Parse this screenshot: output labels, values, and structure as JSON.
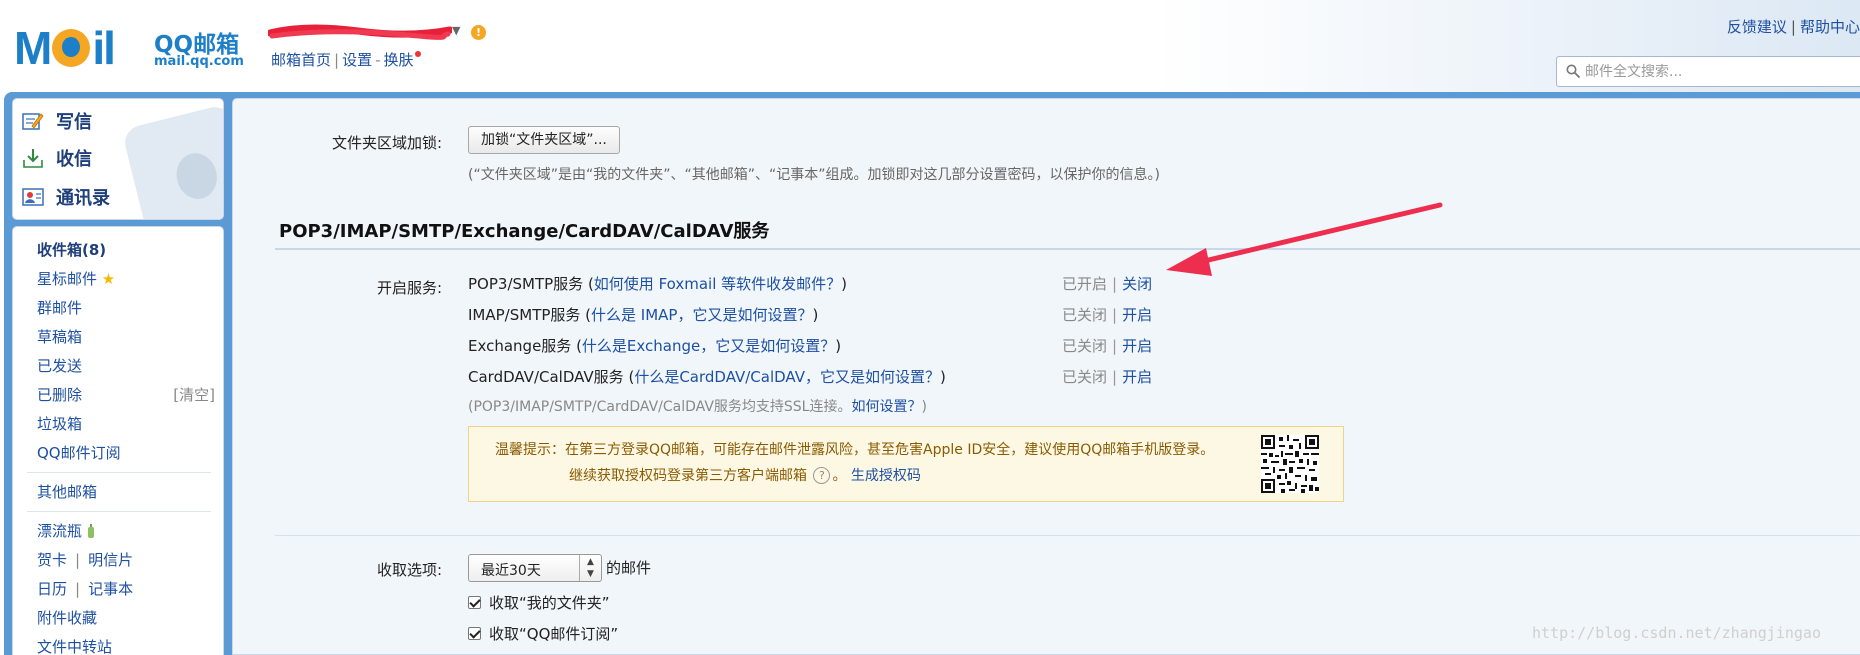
{
  "header": {
    "logo_text": "MOil",
    "logo_name": "QQ邮箱",
    "logo_domain": "mail.qq.com",
    "user_links": [
      "邮箱首页",
      "设置",
      "换肤"
    ],
    "user_links_sep_a": "|",
    "user_links_sep_b": "-",
    "top_right": [
      "反馈建议",
      "帮助中心"
    ],
    "top_right_sep": "|",
    "search_placeholder": "邮件全文搜索..."
  },
  "quick": {
    "write": "写信",
    "receive": "收信",
    "contacts": "通讯录"
  },
  "nav": {
    "inbox": "收件箱(8)",
    "starred": "星标邮件",
    "group": "群邮件",
    "drafts": "草稿箱",
    "sent": "已发送",
    "deleted": "已删除",
    "deleted_aux": "[清空]",
    "spam": "垃圾箱",
    "subscription": "QQ邮件订阅",
    "other": "其他邮箱",
    "bottle": "漂流瓶",
    "card": "贺卡",
    "postcard": "明信片",
    "calendar": "日历",
    "notepad": "记事本",
    "attachments": "附件收藏",
    "transfer": "文件中转站",
    "sep": "|"
  },
  "main": {
    "folder_lock_label": "文件夹区域加锁:",
    "folder_lock_button": "加锁“文件夹区域”...",
    "folder_lock_hint": "(“文件夹区域”是由“我的文件夹”、“其他邮箱”、“记事本”组成。加锁即对这几部分设置密码，以保护你的信息。)",
    "section_title": "POP3/IMAP/SMTP/Exchange/CardDAV/CalDAV服务",
    "services_label": "开启服务:",
    "services": [
      {
        "name": "POP3/SMTP服务",
        "help": "如何使用 Foxmail 等软件收发邮件？",
        "status": "已开启",
        "action": "关闭"
      },
      {
        "name": "IMAP/SMTP服务",
        "help": "什么是 IMAP，它又是如何设置？",
        "status": "已关闭",
        "action": "开启"
      },
      {
        "name": "Exchange服务",
        "help": "什么是Exchange，它又是如何设置？",
        "status": "已关闭",
        "action": "开启"
      },
      {
        "name": "CardDAV/CalDAV服务",
        "help": "什么是CardDAV/CalDAV，它又是如何设置？",
        "status": "已关闭",
        "action": "开启"
      }
    ],
    "status_sep": "|",
    "ssl_note": "(POP3/IMAP/SMTP/CardDAV/CalDAV服务均支持SSL连接。",
    "ssl_help": "如何设置？",
    "ssl_close": ")",
    "tip_line1": "温馨提示：在第三方登录QQ邮箱，可能存在邮件泄露风险，甚至危害Apple ID安全，建议使用QQ邮箱手机版登录。",
    "tip_line2": "继续获取授权码登录第三方客户端邮箱",
    "tip_q": "?",
    "tip_line2_end": "。",
    "tip_generate": "生成授权码",
    "fetch_label": "收取选项:",
    "fetch_value": "最近30天",
    "fetch_suffix": "的邮件",
    "fetch_my_folders": "收取“我的文件夹”",
    "fetch_subscription": "收取“QQ邮件订阅”"
  },
  "watermark": "http://blog.csdn.net/zhangjingao",
  "colors": {
    "link": "#1e50a2",
    "frame": "#5b9bd5",
    "annotation_arrow": "#ee2e4f",
    "tip_bg": "#fdf8e4"
  }
}
